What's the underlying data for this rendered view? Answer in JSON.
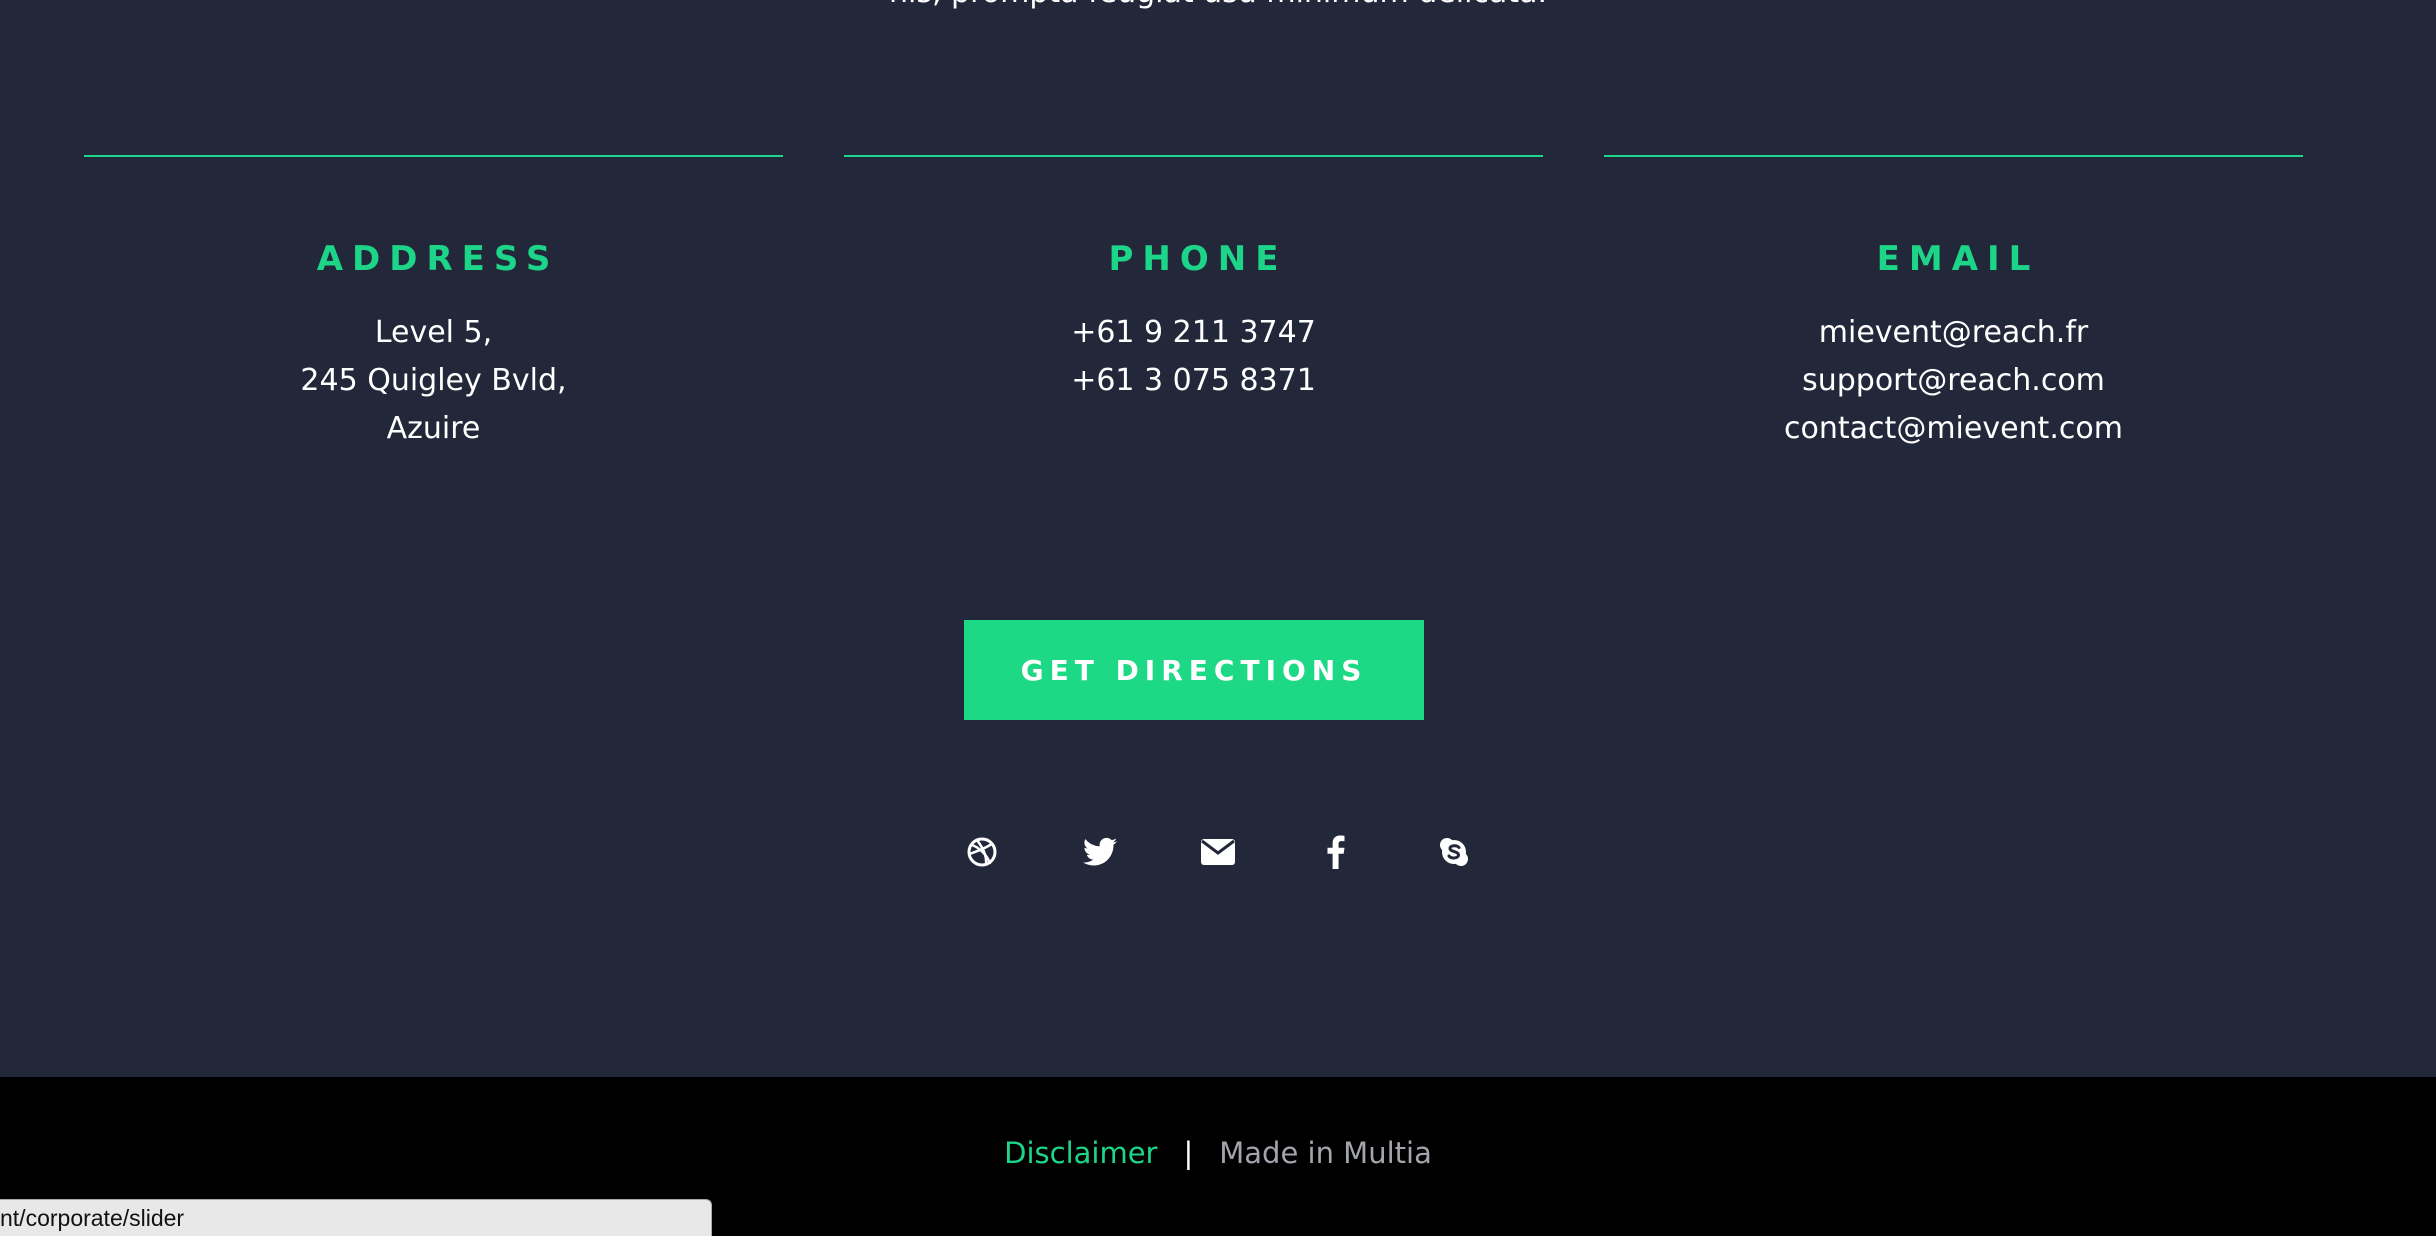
{
  "intro": {
    "partial_text": "nis, prompta feugiat usu minimum delicata."
  },
  "contact": {
    "address": {
      "heading": "ADDRESS",
      "lines": [
        "Level 5,",
        "245 Quigley Bvld,",
        "Azuire"
      ]
    },
    "phone": {
      "heading": "PHONE",
      "lines": [
        "+61 9 211 3747",
        "+61 3 075 8371"
      ]
    },
    "email": {
      "heading": "EMAIL",
      "lines": [
        "mievent@reach.fr",
        "support@reach.com",
        "contact@mievent.com"
      ]
    }
  },
  "cta": {
    "label": "GET DIRECTIONS"
  },
  "social": {
    "icons": [
      "dribbble-icon",
      "twitter-icon",
      "envelope-icon",
      "facebook-icon",
      "skype-icon"
    ]
  },
  "footer": {
    "disclaimer": "Disclaimer",
    "separator": "|",
    "made_in": "Made in Multia"
  },
  "status_bar": {
    "url": "nt/corporate/slider"
  },
  "colors": {
    "background": "#222839",
    "accent": "#1dd588",
    "footer_bg": "#000000"
  }
}
